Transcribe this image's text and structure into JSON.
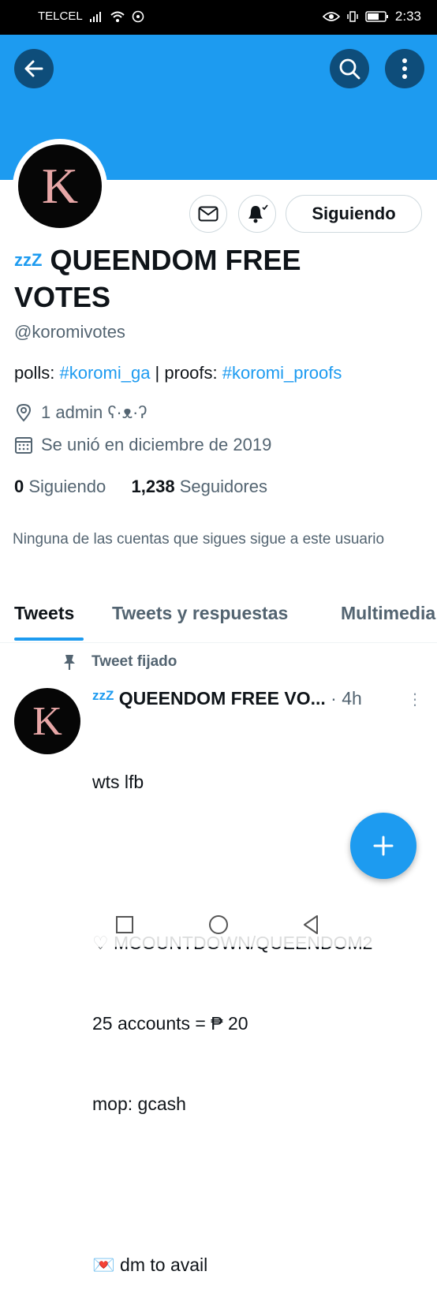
{
  "status": {
    "carrier": "TELCEL",
    "time": "2:33"
  },
  "header": {
    "back_icon": "arrow-left-icon",
    "search_icon": "search-icon",
    "more_icon": "vertical-dots-icon"
  },
  "profile": {
    "avatar_letter": "K",
    "dm_icon": "envelope-icon",
    "notify_icon": "bell-icon",
    "follow_button": "Siguiendo",
    "zzz": "zzZ",
    "name": "QUEENDOM FREE VOTES",
    "handle": "@koromivotes",
    "bio": {
      "polls_label": "polls: ",
      "polls_tag": "#koromi_ga",
      "separator": " | proofs: ",
      "proofs_tag": "#koromi_proofs"
    },
    "location": "1 admin ʕ·ᴥ·ʔ",
    "joined": "Se unió en diciembre de 2019",
    "following_count": "0",
    "following_label": "Siguiendo",
    "followers_count": "1,238",
    "followers_label": "Seguidores",
    "followers_you_know": "Ninguna de las cuentas que sigues sigue a este usuario"
  },
  "tabs": [
    {
      "label": "Tweets",
      "active": true
    },
    {
      "label": "Tweets y respuestas",
      "active": false
    },
    {
      "label": "Multimedia",
      "active": false
    }
  ],
  "pinned_label": "Tweet fijado",
  "tweet": {
    "avatar_letter": "K",
    "zzz": "zzZ",
    "name": "QUEENDOM FREE VO...",
    "time": " · 4h",
    "lines": [
      "wts lfb",
      "",
      "♡ MCOUNTDOWN/QUEENDOM2",
      "25 accounts = ₱ 20",
      "mop: gcash",
      "",
      "💌 dm to avail"
    ]
  },
  "fab_icon": "plus-icon",
  "colors": {
    "accent": "#1d9bf0",
    "text": "#0f1419",
    "muted": "#536471",
    "header_button": "#0e4d7a"
  }
}
